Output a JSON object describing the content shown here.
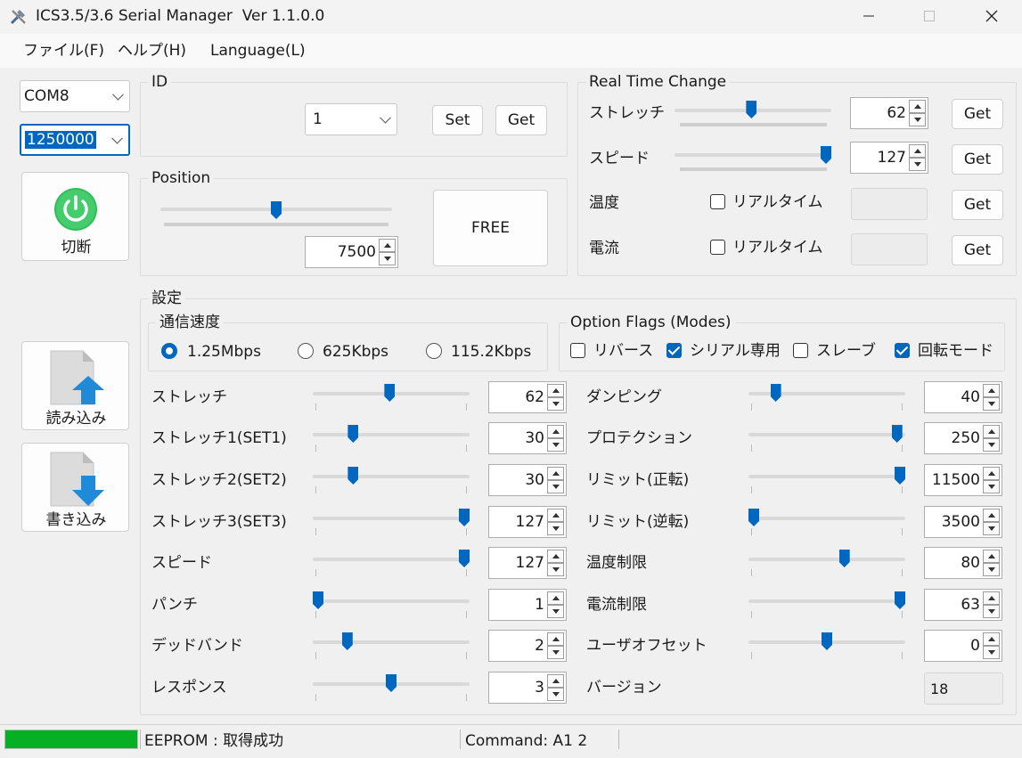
{
  "window": {
    "title": "ICS3.5/3.6 Serial Manager  Ver 1.1.0.0",
    "minimize_glyph": "—",
    "maximize_glyph": "☐",
    "close_glyph": "✕"
  },
  "menu": {
    "file": "ファイル(F)",
    "help": "ヘルプ(H)",
    "language": "Language(L)"
  },
  "left_panel": {
    "port": "COM8",
    "baud": "1250000",
    "disconnect_label": "切断",
    "read_label": "読み込み",
    "write_label": "書き込み"
  },
  "id_group": {
    "title": "ID",
    "id_value": "1",
    "set_label": "Set",
    "get_label": "Get"
  },
  "position_group": {
    "title": "Position",
    "slider_fraction": 0.5,
    "value": "7500",
    "free_label": "FREE"
  },
  "realtime": {
    "title": "Real Time Change",
    "stretch_label": "ストレッチ",
    "stretch_value": "62",
    "stretch_fraction": 0.49,
    "speed_label": "スピード",
    "speed_value": "127",
    "speed_fraction": 1.0,
    "temp_label": "温度",
    "temp_check": "リアルタイム",
    "current_label": "電流",
    "current_check": "リアルタイム",
    "get_label": "Get"
  },
  "settings": {
    "title": "設定",
    "comm_speed": {
      "title": "通信速度",
      "options": [
        "1.25Mbps",
        "625Kbps",
        "115.2Kbps"
      ],
      "selected": "1.25Mbps"
    },
    "option_flags": {
      "title": "Option Flags (Modes)",
      "reverse": "リバース",
      "reverse_checked": false,
      "serial_only": "シリアル専用",
      "serial_only_checked": true,
      "slave": "スレーブ",
      "slave_checked": false,
      "rotation_mode": "回転モード",
      "rotation_mode_checked": true
    },
    "left_params": [
      {
        "label": "ストレッチ",
        "value": "62",
        "fraction": 0.49
      },
      {
        "label": "ストレッチ1(SET1)",
        "value": "30",
        "fraction": 0.24
      },
      {
        "label": "ストレッチ2(SET2)",
        "value": "30",
        "fraction": 0.24
      },
      {
        "label": "ストレッチ3(SET3)",
        "value": "127",
        "fraction": 1.0
      },
      {
        "label": "スピード",
        "value": "127",
        "fraction": 1.0
      },
      {
        "label": "パンチ",
        "value": "1",
        "fraction": 0.0
      },
      {
        "label": "デッドバンド",
        "value": "2",
        "fraction": 0.2
      },
      {
        "label": "レスポンス",
        "value": "3",
        "fraction": 0.5
      }
    ],
    "right_params": [
      {
        "label": "ダンピング",
        "value": "40",
        "fraction": 0.15
      },
      {
        "label": "プロテクション",
        "value": "250",
        "fraction": 0.98
      },
      {
        "label": "リミット(正転)",
        "value": "11500",
        "fraction": 1.0
      },
      {
        "label": "リミット(逆転)",
        "value": "3500",
        "fraction": 0.0
      },
      {
        "label": "温度制限",
        "value": "80",
        "fraction": 0.62
      },
      {
        "label": "電流制限",
        "value": "63",
        "fraction": 1.0
      },
      {
        "label": "ユーザオフセット",
        "value": "0",
        "fraction": 0.5
      }
    ],
    "version_label": "バージョン",
    "version_value": "18"
  },
  "status": {
    "progress": 1.0,
    "eeprom": "EEPROM : 取得成功",
    "command": "Command: A1 2"
  },
  "colors": {
    "accent": "#0067c0",
    "power_green": "#2fbf5a",
    "progress_green": "#06b025",
    "arrow_blue": "#1f8ad8"
  }
}
